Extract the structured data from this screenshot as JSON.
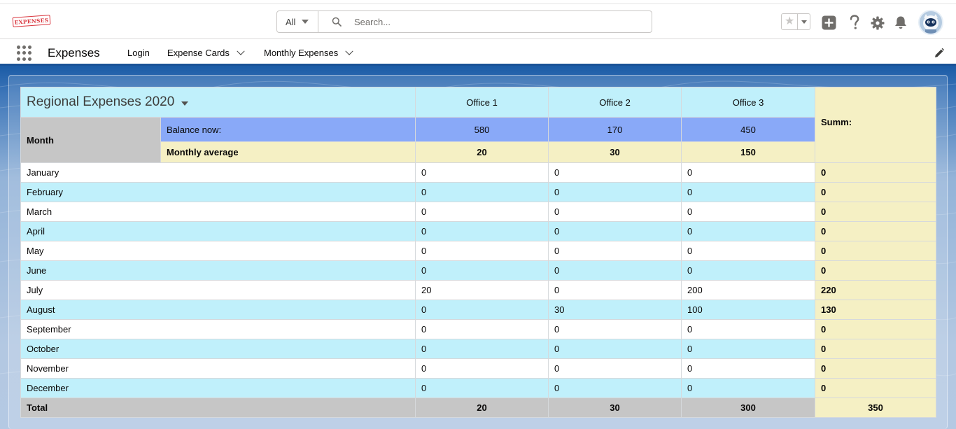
{
  "header": {
    "logo_text": "EXPENSES",
    "search": {
      "scope": "All",
      "placeholder": "Search..."
    }
  },
  "nav": {
    "app_name": "Expenses",
    "items": [
      {
        "label": "Login",
        "has_menu": false
      },
      {
        "label": "Expense Cards",
        "has_menu": true
      },
      {
        "label": "Monthly Expenses",
        "has_menu": true
      }
    ]
  },
  "table": {
    "title": "Regional Expenses 2020",
    "offices": [
      "Office 1",
      "Office 2",
      "Office 3"
    ],
    "summ_label": "Summ:",
    "month_label": "Month",
    "balance_label": "Balance now:",
    "balance_values": [
      "580",
      "170",
      "450"
    ],
    "average_label": "Monthly average",
    "average_values": [
      "20",
      "30",
      "150"
    ],
    "rows": [
      {
        "month": "January",
        "values": [
          "0",
          "0",
          "0"
        ],
        "sum": "0"
      },
      {
        "month": "February",
        "values": [
          "0",
          "0",
          "0"
        ],
        "sum": "0"
      },
      {
        "month": "March",
        "values": [
          "0",
          "0",
          "0"
        ],
        "sum": "0"
      },
      {
        "month": "April",
        "values": [
          "0",
          "0",
          "0"
        ],
        "sum": "0"
      },
      {
        "month": "May",
        "values": [
          "0",
          "0",
          "0"
        ],
        "sum": "0"
      },
      {
        "month": "June",
        "values": [
          "0",
          "0",
          "0"
        ],
        "sum": "0"
      },
      {
        "month": "July",
        "values": [
          "20",
          "0",
          "200"
        ],
        "sum": "220"
      },
      {
        "month": "August",
        "values": [
          "0",
          "30",
          "100"
        ],
        "sum": "130"
      },
      {
        "month": "September",
        "values": [
          "0",
          "0",
          "0"
        ],
        "sum": "0"
      },
      {
        "month": "October",
        "values": [
          "0",
          "0",
          "0"
        ],
        "sum": "0"
      },
      {
        "month": "November",
        "values": [
          "0",
          "0",
          "0"
        ],
        "sum": "0"
      },
      {
        "month": "December",
        "values": [
          "0",
          "0",
          "0"
        ],
        "sum": "0"
      }
    ],
    "total": {
      "label": "Total",
      "values": [
        "20",
        "30",
        "300"
      ],
      "sum": "350"
    }
  },
  "colors": {
    "header_cyan": "#c0f0fb",
    "balance_blue": "#89a9f8",
    "summ_yellow": "#f5f0c4",
    "label_red": "#e8001c",
    "month_blue": "#0000e0",
    "office_blue": "#1a5a96",
    "grey": "#c6c6c6"
  },
  "icons": [
    "search-icon",
    "favorite-star-icon",
    "add-icon",
    "help-icon",
    "setup-gear-icon",
    "notification-bell-icon",
    "app-launcher-icon",
    "edit-pencil-icon"
  ]
}
